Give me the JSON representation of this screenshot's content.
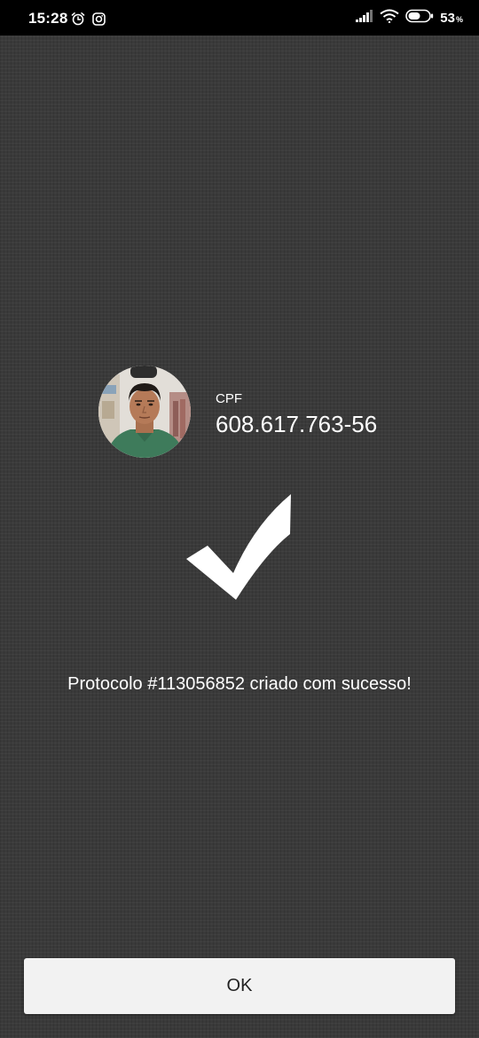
{
  "status_bar": {
    "time": "15:28",
    "left_icons": [
      "alarm-icon",
      "instagram-icon"
    ],
    "right_icons": [
      "signal-icon",
      "wifi-icon",
      "battery-icon"
    ],
    "battery_percent": "53",
    "battery_unit": "%"
  },
  "profile": {
    "cpf_label": "CPF",
    "cpf_value": "608.617.763-56"
  },
  "message": "Protocolo #113056852 criado com sucesso!",
  "ok_button": {
    "label": "OK"
  },
  "colors": {
    "background": "#3a3a3a",
    "status_bar": "#000000",
    "text": "#ffffff",
    "button_bg": "#f2f2f2",
    "button_text": "#222222"
  }
}
